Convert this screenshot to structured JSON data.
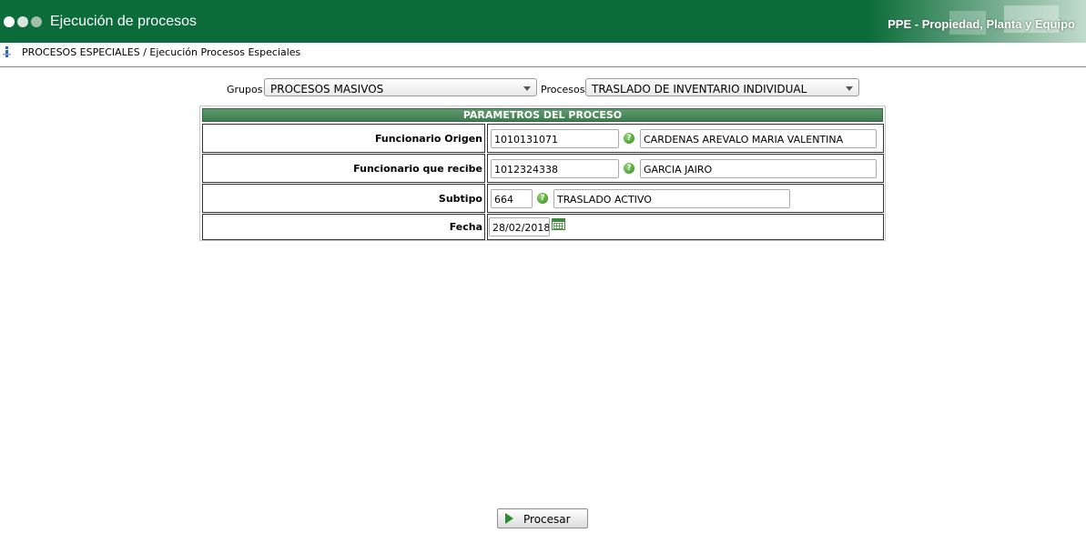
{
  "header": {
    "title": "Ejecución de procesos",
    "brand": "PPE - Propiedad, Planta y Equipo"
  },
  "breadcrumb": "PROCESOS ESPECIALES / Ejecución Procesos Especiales",
  "filters": {
    "grupos_label": "Grupos:",
    "grupos_value": "PROCESOS MASIVOS",
    "procesos_label": "Procesos:",
    "procesos_value": "TRASLADO DE INVENTARIO INDIVIDUAL"
  },
  "params": {
    "header": "PARAMETROS DEL PROCESO",
    "funcionario_origen": {
      "label": "Funcionario Origen",
      "code": "1010131071",
      "name": "CARDENAS AREVALO MARIA VALENTINA"
    },
    "funcionario_recibe": {
      "label": "Funcionario que recibe",
      "code": "1012324338",
      "name": "GARCIA JAIRO"
    },
    "subtipo": {
      "label": "Subtipo",
      "code": "664",
      "name": "TRASLADO ACTIVO"
    },
    "fecha": {
      "label": "Fecha",
      "value": "28/02/2018"
    }
  },
  "actions": {
    "procesar": "Procesar"
  },
  "icons": {
    "help": "help-icon",
    "calendar": "calendar-icon",
    "info": "info-icon",
    "play": "play-icon"
  },
  "colors": {
    "header_bg": "#0b6b3a",
    "section_header": "#4a8a5a",
    "accent_green": "#2d8a2d"
  }
}
